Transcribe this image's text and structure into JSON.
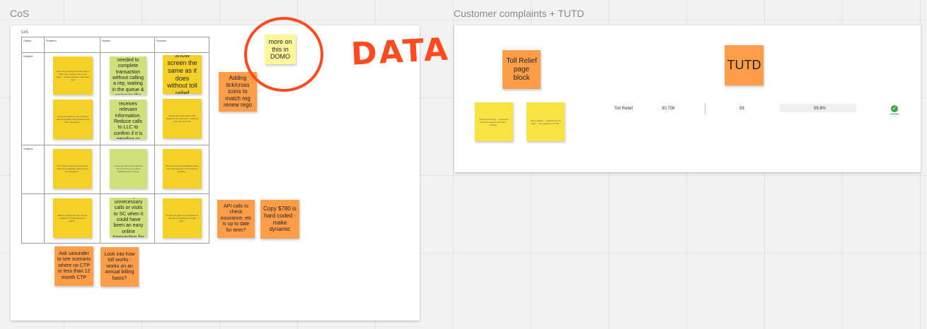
{
  "frames": {
    "cos_title": "CoS",
    "complaints_title": "Customer complaints + TUTD"
  },
  "table": {
    "caption": "CoS",
    "headers": [
      "Status",
      "Problem",
      "Search",
      "Solution"
    ],
    "row_labels": [
      "",
      "Subject",
      "",
      "Subject",
      ""
    ]
  },
  "notes": {
    "n_r1_c1": "When the existing toll notice fails to clear, the customer has to pay again... unclear whether it has been paid.",
    "n_r1_c2": "Customer will know what is needed to complete transaction without calling a rep, waiting in the queue & going to the counter",
    "n_r1_c3": "show screen the same as it does without toll relief",
    "n_r2_c1": "Several customers are not being offered eligibility relief details during their transaction...",
    "n_r2_c2": "Easier digital transactions. Customer receives relevant information. Reduce calls to LLC to confirm if it is pending or green slip missing.",
    "n_r2_c3": "Response in the green if still eligible for the toll relief... customer may see more info.",
    "n_r3_c1": "The customer gets no information about their eligibility status during the transaction...",
    "n_r3_c2": "Customer will receive relevant info and learn more about eligibility before calling.",
    "n_r3_c3": "We could show the eligibility status and relief amount if the customer qualifies...",
    "n_r4_c1": "Where a customer may only be eligible for Toll Relief due to earlier...",
    "n_r4_c2": "This is resulting in unnecessary calls or visits to SC when it could have been an easy online transaction for the customer.",
    "n_r4_c3": "Provide an option for customers to attempt a transaction through web...",
    "adding_tick": "Adding tick/cross icons to match reg renew rego",
    "more_domo": "more on this in DOMO",
    "api_calls": "API calls to check insurance, etc is up to date for term?",
    "copy_780": "Copy $780 is hard coded - make dynamic",
    "ask_uasunder": "Ask uasunder to see scenario where no CTP or less than 12 month CTP",
    "look_toll": "Look into how toll works - works on an annual billing basis?",
    "toll_relief_block": "Toll Relief page block",
    "tutd": "TUTD",
    "c_note1": "Some text during ... customers reach the page for toll relief ... unclear...",
    "c_note2": "Some vehicle ... eligibility for toll relief ... the customer only fits.."
  },
  "annotation": {
    "data_word": "DATA"
  },
  "metrics": {
    "label": "Toll Relief",
    "count": "30,708",
    "value": "59",
    "percent": "59.8%"
  }
}
